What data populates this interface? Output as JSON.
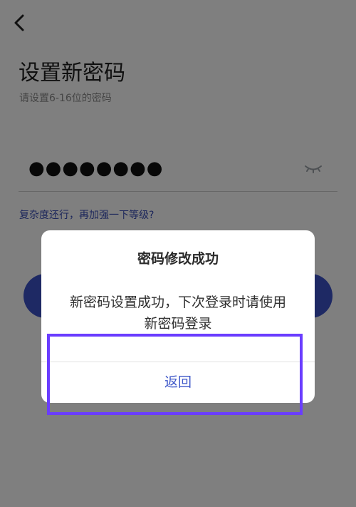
{
  "header": {
    "back_icon": "chevron-left-icon"
  },
  "content": {
    "title": "设置新密码",
    "subtitle": "请设置6-16位的密码",
    "password_mask": "●●●●●●●●",
    "eye_icon": "eye-closed-icon",
    "strength_hint": "复杂度还行，再加强一下等级?"
  },
  "dialog": {
    "title": "密码修改成功",
    "message": "新密码设置成功，下次登录时请使用新密码登录",
    "action_label": "返回"
  },
  "colors": {
    "accent": "#3c52c8",
    "dialog_link": "#3f58c9",
    "highlight": "#6a3dff",
    "overlay": "rgba(0,0,0,0.5)"
  }
}
